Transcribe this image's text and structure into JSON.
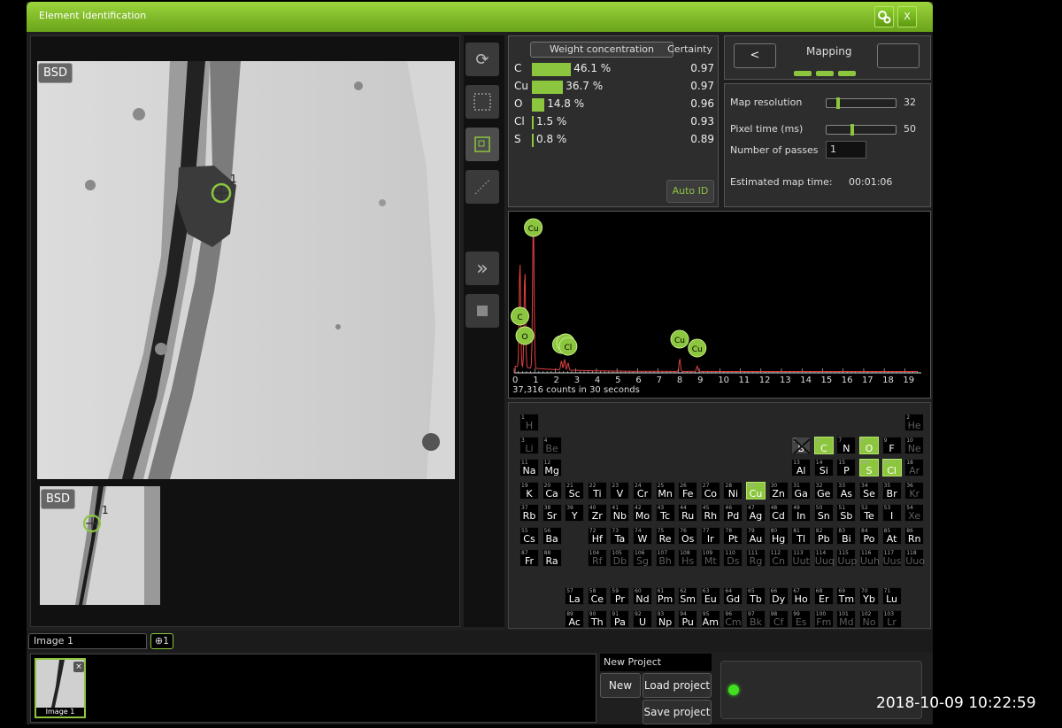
{
  "window": {
    "title": "Element Identification",
    "close_label": "X",
    "settings_icon": "settings-icon"
  },
  "image_view": {
    "badge": "BSD",
    "marker_label": "1"
  },
  "thumbnail": {
    "badge": "BSD",
    "marker_label": "1"
  },
  "tools": [
    "refresh-icon",
    "rect-select-icon",
    "point-select-icon",
    "line-select-icon",
    "fast-forward-icon",
    "stop-icon"
  ],
  "weights": {
    "tab_label": "Weight concentration",
    "certainty_label": "Certainty",
    "rows": [
      {
        "symbol": "C",
        "percent": "46.1 %",
        "value": 46.1,
        "certainty": "0.97"
      },
      {
        "symbol": "Cu",
        "percent": "36.7 %",
        "value": 36.7,
        "certainty": "0.97"
      },
      {
        "symbol": "O",
        "percent": "14.8 %",
        "value": 14.8,
        "certainty": "0.96"
      },
      {
        "symbol": "Cl",
        "percent": "1.5 %",
        "value": 1.5,
        "certainty": "0.93"
      },
      {
        "symbol": "S",
        "percent": "0.8 %",
        "value": 0.8,
        "certainty": "0.89"
      }
    ],
    "auto_id_label": "Auto ID"
  },
  "mapping": {
    "title": "Mapping",
    "prev_label": "<",
    "next_label": "",
    "map_resolution_label": "Map resolution",
    "map_resolution_value": "32",
    "map_resolution_level": 0.15,
    "pixel_time_label": "Pixel time (ms)",
    "pixel_time_value": "50",
    "pixel_time_level": 0.35,
    "passes_label": "Number of passes",
    "passes_value": "1",
    "est_time_label": "Estimated map time:",
    "est_time_value": "00:01:06"
  },
  "spectrum": {
    "counts_text": "37,316 counts in 30 seconds",
    "x_ticks": [
      "0",
      "1",
      "2",
      "3",
      "4",
      "5",
      "6",
      "7",
      "8",
      "9",
      "10",
      "11",
      "12",
      "13",
      "14",
      "15",
      "16",
      "17",
      "18",
      "19"
    ],
    "peak_labels": [
      {
        "label": "Cu",
        "kev": 0.93
      },
      {
        "label": "C",
        "kev": 0.28
      },
      {
        "label": "O",
        "kev": 0.52
      },
      {
        "label": "",
        "kev": 2.3
      },
      {
        "label": "",
        "kev": 2.5
      },
      {
        "label": "Cl",
        "kev": 2.62
      },
      {
        "label": "Cu",
        "kev": 8.05
      },
      {
        "label": "Cu",
        "kev": 8.9
      }
    ]
  },
  "periodic_table": {
    "elements": [
      [
        "1",
        "H",
        1,
        1,
        "dim"
      ],
      [
        "2",
        "He",
        18,
        1,
        "dim"
      ],
      [
        "3",
        "Li",
        1,
        2,
        "dim"
      ],
      [
        "4",
        "Be",
        2,
        2,
        "dim"
      ],
      [
        "5",
        "B",
        13,
        2,
        "x"
      ],
      [
        "6",
        "C",
        14,
        2,
        "hi"
      ],
      [
        "7",
        "N",
        15,
        2,
        ""
      ],
      [
        "8",
        "O",
        16,
        2,
        "hi"
      ],
      [
        "9",
        "F",
        17,
        2,
        ""
      ],
      [
        "10",
        "Ne",
        18,
        2,
        "dim"
      ],
      [
        "11",
        "Na",
        1,
        3,
        ""
      ],
      [
        "12",
        "Mg",
        2,
        3,
        ""
      ],
      [
        "13",
        "Al",
        13,
        3,
        ""
      ],
      [
        "14",
        "Si",
        14,
        3,
        ""
      ],
      [
        "15",
        "P",
        15,
        3,
        ""
      ],
      [
        "16",
        "S",
        16,
        3,
        "hi"
      ],
      [
        "17",
        "Cl",
        17,
        3,
        "hi"
      ],
      [
        "18",
        "Ar",
        18,
        3,
        "dim"
      ],
      [
        "19",
        "K",
        1,
        4,
        ""
      ],
      [
        "20",
        "Ca",
        2,
        4,
        ""
      ],
      [
        "21",
        "Sc",
        3,
        4,
        ""
      ],
      [
        "22",
        "Ti",
        4,
        4,
        ""
      ],
      [
        "23",
        "V",
        5,
        4,
        ""
      ],
      [
        "24",
        "Cr",
        6,
        4,
        ""
      ],
      [
        "25",
        "Mn",
        7,
        4,
        ""
      ],
      [
        "26",
        "Fe",
        8,
        4,
        ""
      ],
      [
        "27",
        "Co",
        9,
        4,
        ""
      ],
      [
        "28",
        "Ni",
        10,
        4,
        ""
      ],
      [
        "29",
        "Cu",
        11,
        4,
        "hi"
      ],
      [
        "30",
        "Zn",
        12,
        4,
        ""
      ],
      [
        "31",
        "Ga",
        13,
        4,
        ""
      ],
      [
        "32",
        "Ge",
        14,
        4,
        ""
      ],
      [
        "33",
        "As",
        15,
        4,
        ""
      ],
      [
        "34",
        "Se",
        16,
        4,
        ""
      ],
      [
        "35",
        "Br",
        17,
        4,
        ""
      ],
      [
        "36",
        "Kr",
        18,
        4,
        "dim"
      ],
      [
        "37",
        "Rb",
        1,
        5,
        ""
      ],
      [
        "38",
        "Sr",
        2,
        5,
        ""
      ],
      [
        "39",
        "Y",
        3,
        5,
        ""
      ],
      [
        "40",
        "Zr",
        4,
        5,
        ""
      ],
      [
        "41",
        "Nb",
        5,
        5,
        ""
      ],
      [
        "42",
        "Mo",
        6,
        5,
        ""
      ],
      [
        "43",
        "Tc",
        7,
        5,
        ""
      ],
      [
        "44",
        "Ru",
        8,
        5,
        ""
      ],
      [
        "45",
        "Rh",
        9,
        5,
        ""
      ],
      [
        "46",
        "Pd",
        10,
        5,
        ""
      ],
      [
        "47",
        "Ag",
        11,
        5,
        ""
      ],
      [
        "48",
        "Cd",
        12,
        5,
        ""
      ],
      [
        "49",
        "In",
        13,
        5,
        ""
      ],
      [
        "50",
        "Sn",
        14,
        5,
        ""
      ],
      [
        "51",
        "Sb",
        15,
        5,
        ""
      ],
      [
        "52",
        "Te",
        16,
        5,
        ""
      ],
      [
        "53",
        "I",
        17,
        5,
        ""
      ],
      [
        "54",
        "Xe",
        18,
        5,
        "dim"
      ],
      [
        "55",
        "Cs",
        1,
        6,
        ""
      ],
      [
        "56",
        "Ba",
        2,
        6,
        ""
      ],
      [
        "72",
        "Hf",
        4,
        6,
        ""
      ],
      [
        "73",
        "Ta",
        5,
        6,
        ""
      ],
      [
        "74",
        "W",
        6,
        6,
        ""
      ],
      [
        "75",
        "Re",
        7,
        6,
        ""
      ],
      [
        "76",
        "Os",
        8,
        6,
        ""
      ],
      [
        "77",
        "Ir",
        9,
        6,
        ""
      ],
      [
        "78",
        "Pt",
        10,
        6,
        ""
      ],
      [
        "79",
        "Au",
        11,
        6,
        ""
      ],
      [
        "80",
        "Hg",
        12,
        6,
        ""
      ],
      [
        "81",
        "Tl",
        13,
        6,
        ""
      ],
      [
        "82",
        "Pb",
        14,
        6,
        ""
      ],
      [
        "83",
        "Bi",
        15,
        6,
        ""
      ],
      [
        "84",
        "Po",
        16,
        6,
        ""
      ],
      [
        "85",
        "At",
        17,
        6,
        ""
      ],
      [
        "86",
        "Rn",
        18,
        6,
        ""
      ],
      [
        "87",
        "Fr",
        1,
        7,
        ""
      ],
      [
        "88",
        "Ra",
        2,
        7,
        ""
      ],
      [
        "104",
        "Rf",
        4,
        7,
        "dim"
      ],
      [
        "105",
        "Db",
        5,
        7,
        "dim"
      ],
      [
        "106",
        "Sg",
        6,
        7,
        "dim"
      ],
      [
        "107",
        "Bh",
        7,
        7,
        "dim"
      ],
      [
        "108",
        "Hs",
        8,
        7,
        "dim"
      ],
      [
        "109",
        "Mt",
        9,
        7,
        "dim"
      ],
      [
        "110",
        "Ds",
        10,
        7,
        "dim"
      ],
      [
        "111",
        "Rg",
        11,
        7,
        "dim"
      ],
      [
        "112",
        "Cn",
        12,
        7,
        "dim"
      ],
      [
        "113",
        "Uut",
        13,
        7,
        "dim"
      ],
      [
        "114",
        "Uuq",
        14,
        7,
        "dim"
      ],
      [
        "115",
        "Uup",
        15,
        7,
        "dim"
      ],
      [
        "116",
        "Uuh",
        16,
        7,
        "dim"
      ],
      [
        "117",
        "Uus",
        17,
        7,
        "dim"
      ],
      [
        "118",
        "Uuo",
        18,
        7,
        "dim"
      ],
      [
        "57",
        "La",
        3,
        9,
        ""
      ],
      [
        "58",
        "Ce",
        4,
        9,
        ""
      ],
      [
        "59",
        "Pr",
        5,
        9,
        ""
      ],
      [
        "60",
        "Nd",
        6,
        9,
        ""
      ],
      [
        "61",
        "Pm",
        7,
        9,
        ""
      ],
      [
        "62",
        "Sm",
        8,
        9,
        ""
      ],
      [
        "63",
        "Eu",
        9,
        9,
        ""
      ],
      [
        "64",
        "Gd",
        10,
        9,
        ""
      ],
      [
        "65",
        "Tb",
        11,
        9,
        ""
      ],
      [
        "66",
        "Dy",
        12,
        9,
        ""
      ],
      [
        "67",
        "Ho",
        13,
        9,
        ""
      ],
      [
        "68",
        "Er",
        14,
        9,
        ""
      ],
      [
        "69",
        "Tm",
        15,
        9,
        ""
      ],
      [
        "70",
        "Yb",
        16,
        9,
        ""
      ],
      [
        "71",
        "Lu",
        17,
        9,
        ""
      ],
      [
        "89",
        "Ac",
        3,
        10,
        ""
      ],
      [
        "90",
        "Th",
        4,
        10,
        ""
      ],
      [
        "91",
        "Pa",
        5,
        10,
        ""
      ],
      [
        "92",
        "U",
        6,
        10,
        ""
      ],
      [
        "93",
        "Np",
        7,
        10,
        ""
      ],
      [
        "94",
        "Pu",
        8,
        10,
        ""
      ],
      [
        "95",
        "Am",
        9,
        10,
        ""
      ],
      [
        "96",
        "Cm",
        10,
        10,
        "dim"
      ],
      [
        "97",
        "Bk",
        11,
        10,
        "dim"
      ],
      [
        "98",
        "Cf",
        12,
        10,
        "dim"
      ],
      [
        "99",
        "Es",
        13,
        10,
        "dim"
      ],
      [
        "100",
        "Fm",
        14,
        10,
        "dim"
      ],
      [
        "101",
        "Md",
        15,
        10,
        "dim"
      ],
      [
        "102",
        "No",
        16,
        10,
        "dim"
      ],
      [
        "103",
        "Lr",
        17,
        10,
        "dim"
      ]
    ]
  },
  "bottom": {
    "image_tab": "Image 1",
    "marker_tab": "⊕1",
    "thumb_caption": "Image 1",
    "thumb_close": "×",
    "project_label": "New Project",
    "new_btn": "New",
    "load_btn": "Load project",
    "save_btn": "Save project"
  },
  "timestamp": "2018-10-09  10:22:59",
  "colors": {
    "accent": "#8cc63f",
    "title_bar": "#7cbf24",
    "led": "#41e01f"
  }
}
